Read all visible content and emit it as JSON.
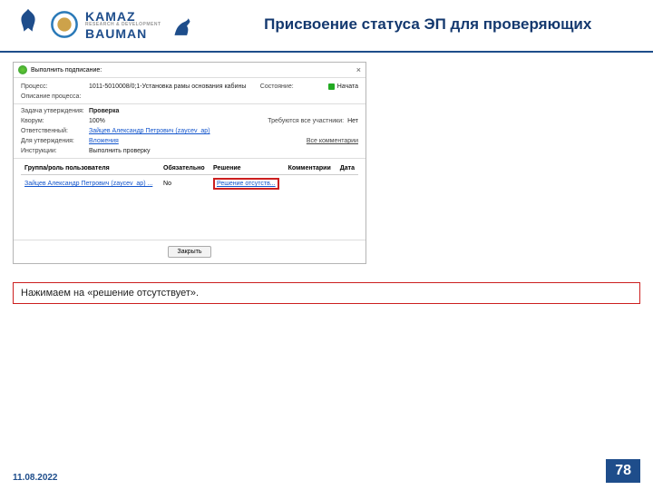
{
  "slide": {
    "title": "Присвоение статуса ЭП для проверяющих",
    "date": "11.08.2022",
    "page": "78"
  },
  "logos": {
    "kamaz_top": "KAMAZ",
    "kamaz_sub": "RESEARCH & DEVELOPMENT",
    "kamaz_bottom": "BAUMAN"
  },
  "dialog": {
    "title": "Выполнить подписание:",
    "close": "×",
    "fields": {
      "process_lbl": "Процесс:",
      "process_val": "1011-5010008/0;1-Установка рамы основания кабины",
      "state_lbl": "Состояние:",
      "state_val": "Начата",
      "desc_lbl": "Описание процесса:",
      "desc_val": "",
      "task_lbl": "Задача утверждения:",
      "task_val": "Проверка",
      "quorum_lbl": "Кворум:",
      "quorum_val": "100%",
      "allreq_lbl": "Требуются все участники:",
      "allreq_val": "Нет",
      "resp_lbl": "Ответственный:",
      "resp_val": "Зайцев Александр Петрович (zaycev_ap)",
      "approval_lbl": "Для утверждения:",
      "approval_val": "Вложения",
      "allcomments": "Все комментарии",
      "instr_lbl": "Инструкции:",
      "instr_val": "Выполнить проверку"
    },
    "table": {
      "h_group": "Группа/роль пользователя",
      "h_req": "Обязательно",
      "h_dec": "Решение",
      "h_com": "Комментарии",
      "h_date": "Дата",
      "r_user": "Зайцев Александр Петрович (zaycev_ap) ...",
      "r_req": "No",
      "r_dec": "Решение отсутств..."
    },
    "close_btn": "Закрыть"
  },
  "instruction": "Нажимаем на «решение отсутствует»."
}
